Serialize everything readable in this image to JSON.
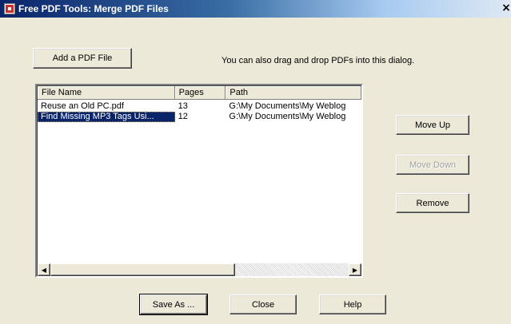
{
  "window": {
    "title": "Free PDF Tools: Merge PDF Files",
    "close_glyph": "×"
  },
  "toolbar": {
    "add_label": "Add a PDF File",
    "hint": "You can also drag and drop PDFs into this dialog."
  },
  "list": {
    "columns": [
      "File Name",
      "Pages",
      "Path"
    ],
    "rows": [
      {
        "name": "Reuse an Old PC.pdf",
        "pages": "13",
        "path": "G:\\My Documents\\My Weblog",
        "selected": false
      },
      {
        "name": "Find Missing MP3 Tags Usi...",
        "pages": "12",
        "path": "G:\\My Documents\\My Weblog",
        "selected": true
      }
    ],
    "scroll_left_glyph": "◀",
    "scroll_right_glyph": "▶",
    "scroll_thumb_fraction": 0.62
  },
  "side_buttons": {
    "move_up": "Move Up",
    "move_down": "Move Down",
    "remove": "Remove"
  },
  "footer": {
    "save_as": "Save As ...",
    "close": "Close",
    "help": "Help"
  },
  "colors": {
    "dialog_bg": "#ece9d8",
    "title_bar": "#0a246a",
    "selection": "#0a246a"
  },
  "icons": {
    "app": "pdf-app-icon",
    "close": "close-icon",
    "scroll_left": "scroll-left-arrow-icon",
    "scroll_right": "scroll-right-arrow-icon"
  }
}
